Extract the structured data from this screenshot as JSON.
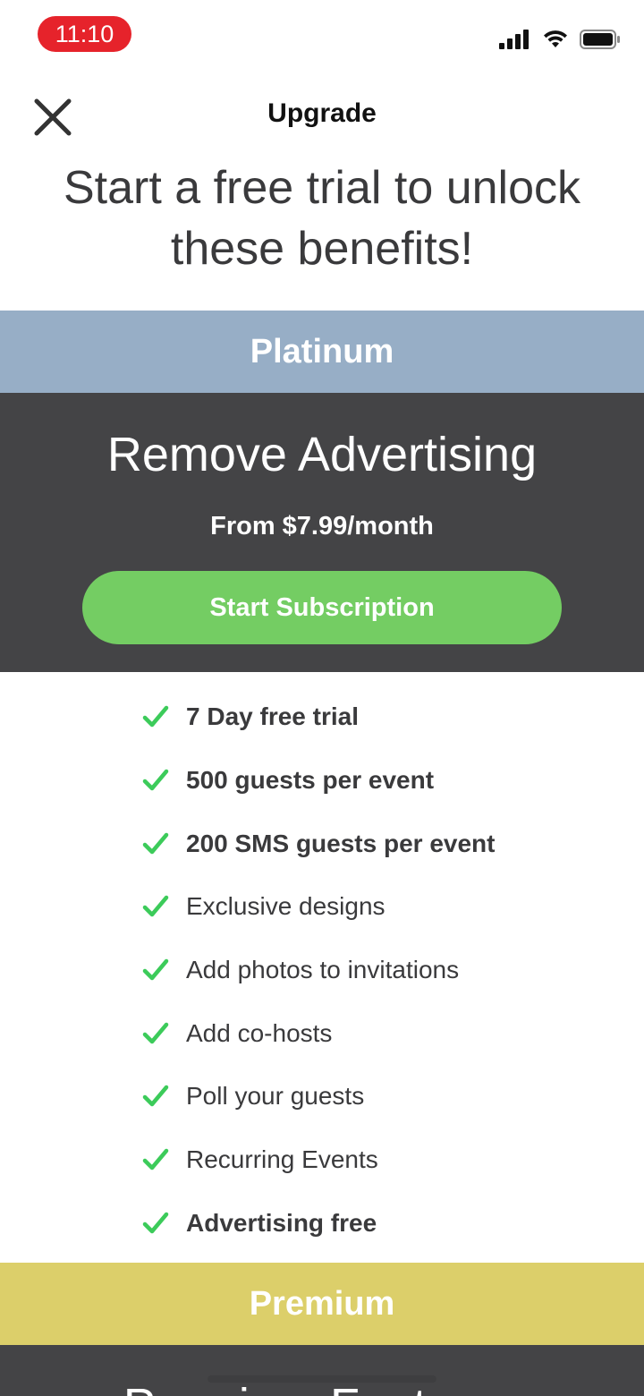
{
  "status_bar": {
    "time": "11:10",
    "icons": [
      "cellular-signal-icon",
      "wifi-icon",
      "battery-icon"
    ],
    "time_pill_color": "#e6232b"
  },
  "header": {
    "title": "Upgrade",
    "close_icon": "close-icon"
  },
  "hero": {
    "text": "Start a free trial to unlock these benefits!"
  },
  "platinum": {
    "tier_name": "Platinum",
    "band_color": "#97aec6",
    "panel_color": "#444446",
    "headline": "Remove Advertising",
    "price": "From $7.99/month",
    "button_label": "Start Subscription",
    "button_color": "#74cd63",
    "benefits": [
      {
        "label": "7 Day free trial",
        "bold": true
      },
      {
        "label": "500 guests per event",
        "bold": true
      },
      {
        "label": "200 SMS guests per event",
        "bold": true
      },
      {
        "label": "Exclusive designs",
        "bold": false
      },
      {
        "label": "Add photos to invitations",
        "bold": false
      },
      {
        "label": "Add co-hosts",
        "bold": false
      },
      {
        "label": "Poll your guests",
        "bold": false
      },
      {
        "label": "Recurring Events",
        "bold": false
      },
      {
        "label": "Advertising free",
        "bold": true
      }
    ],
    "check_icon": "checkmark-icon",
    "check_color": "#3ccb5a"
  },
  "premium": {
    "tier_name": "Premium",
    "band_color": "#dccf6a",
    "headline": "Premium Features"
  }
}
